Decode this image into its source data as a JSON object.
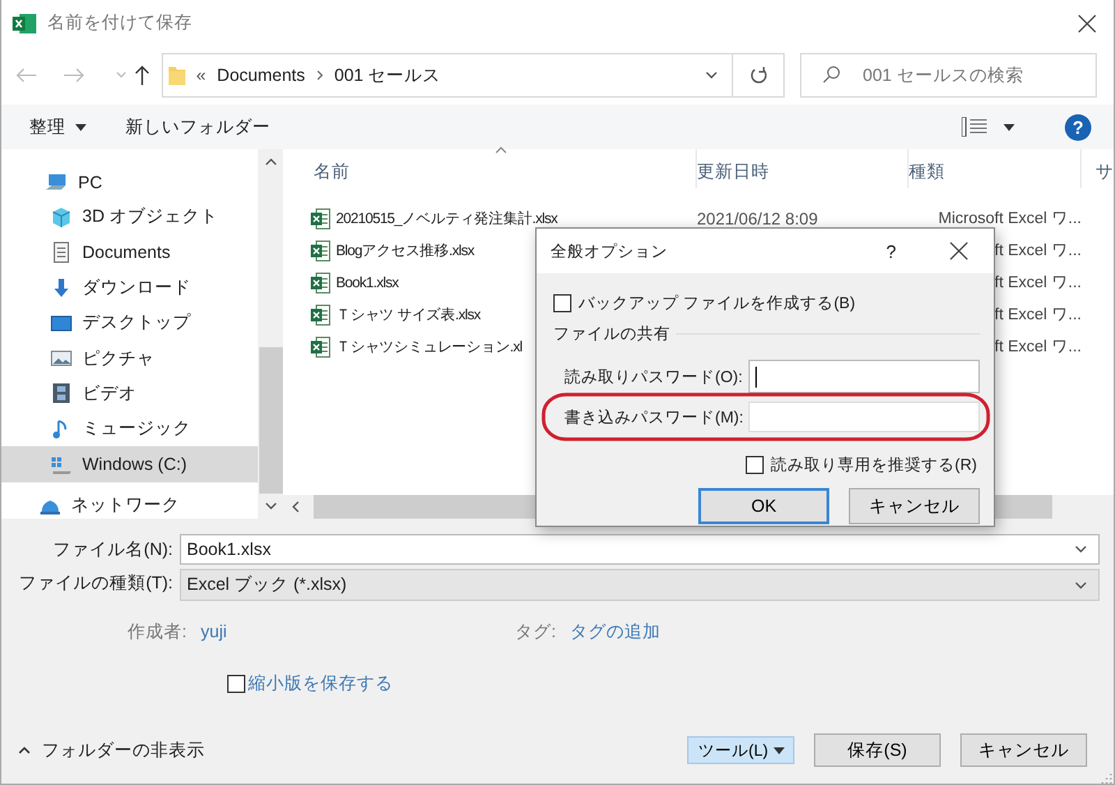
{
  "window": {
    "title": "名前を付けて保存"
  },
  "address": {
    "overflow": "«",
    "path": [
      "Documents",
      "001 セールス"
    ],
    "search": {
      "placeholder": "001 セールスの検索"
    }
  },
  "toolbar": {
    "organize": "整理",
    "new_folder": "新しいフォルダー",
    "help": "?"
  },
  "sidebar": {
    "items": [
      {
        "label": "PC",
        "kind": "pc",
        "selected": false,
        "children": [
          {
            "label": "3D オブジェクト",
            "kind": "objects",
            "selected": false
          },
          {
            "label": "Documents",
            "kind": "documents",
            "selected": false
          },
          {
            "label": "ダウンロード",
            "kind": "downloads",
            "selected": false
          },
          {
            "label": "デスクトップ",
            "kind": "desktop",
            "selected": false
          },
          {
            "label": "ピクチャ",
            "kind": "pictures",
            "selected": false
          },
          {
            "label": "ビデオ",
            "kind": "videos",
            "selected": false
          },
          {
            "label": "ミュージック",
            "kind": "music",
            "selected": false
          },
          {
            "label": "Windows (C:)",
            "kind": "drive",
            "selected": true
          }
        ]
      },
      {
        "label": "ネットワーク",
        "kind": "network",
        "selected": false
      }
    ]
  },
  "file_list": {
    "columns": [
      "名前",
      "更新日時",
      "種類",
      "サ"
    ],
    "rows": [
      {
        "name": "20210515_ノベルティ発注集計.xlsx",
        "modified": "2021/06/12 8:09",
        "type": "Microsoft Excel ワ..."
      },
      {
        "name": "Blogアクセス推移.xlsx",
        "type": "ft Excel ワ..."
      },
      {
        "name": "Book1.xlsx",
        "type": "ft Excel ワ..."
      },
      {
        "name": "Ｔシャツ サイズ表.xlsx",
        "type": "ft Excel ワ..."
      },
      {
        "name": "Ｔシャツシミュレーション.xl",
        "type": "ft Excel ワ..."
      }
    ]
  },
  "form": {
    "file_name": {
      "label": "ファイル名(N):",
      "value": "Book1.xlsx"
    },
    "file_type": {
      "label": "ファイルの種類(T):",
      "value": "Excel ブック (*.xlsx)"
    },
    "author": {
      "label": "作成者:",
      "value": "yuji"
    },
    "tags": {
      "label": "タグ:",
      "value": "タグの追加"
    },
    "thumbnail": {
      "label": "縮小版を保存する",
      "checked": false
    },
    "hide_folders": "フォルダーの非表示",
    "buttons": [
      {
        "label": "ツール(L)",
        "kind": "menu"
      },
      {
        "label": "保存(S)",
        "kind": "normal"
      },
      {
        "label": "キャンセル",
        "kind": "normal"
      }
    ]
  },
  "options_dialog": {
    "title": "全般オプション",
    "help": "?",
    "backup": {
      "label": "バックアップ ファイルを作成する(B)",
      "checked": false
    },
    "group": "ファイルの共有",
    "fields": [
      {
        "label": "読み取りパスワード(O):",
        "focused": true,
        "highlighted": false
      },
      {
        "label": "書き込みパスワード(M):",
        "focused": false,
        "highlighted": true
      }
    ],
    "read_only": {
      "label": "読み取り専用を推奨する(R)",
      "checked": false
    },
    "buttons": [
      {
        "label": "OK",
        "default": true
      },
      {
        "label": "キャンセル",
        "default": false
      }
    ]
  }
}
